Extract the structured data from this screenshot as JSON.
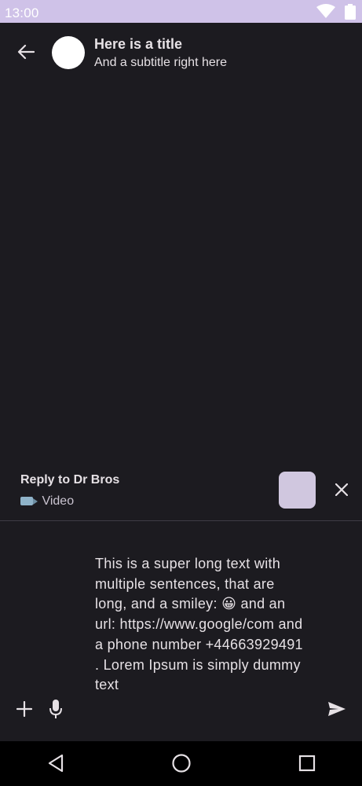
{
  "status_bar": {
    "time": "13:00"
  },
  "app_bar": {
    "title": "Here is a title",
    "subtitle": "And a subtitle right here"
  },
  "reply": {
    "title": "Reply to Dr Bros",
    "type_label": "Video",
    "type_icon": "video-camera-icon"
  },
  "composer": {
    "text": "This is a super long text with multiple sentences, that are long, and a smiley: 😀 and an url: https://www.google/com and a phone number +44663929491 . Lorem Ipsum is simply dummy text"
  },
  "colors": {
    "status_bar": "#cfc2e8",
    "background": "#1c1b20",
    "thumbnail": "#d0c7df",
    "nav_bar": "#000000"
  }
}
